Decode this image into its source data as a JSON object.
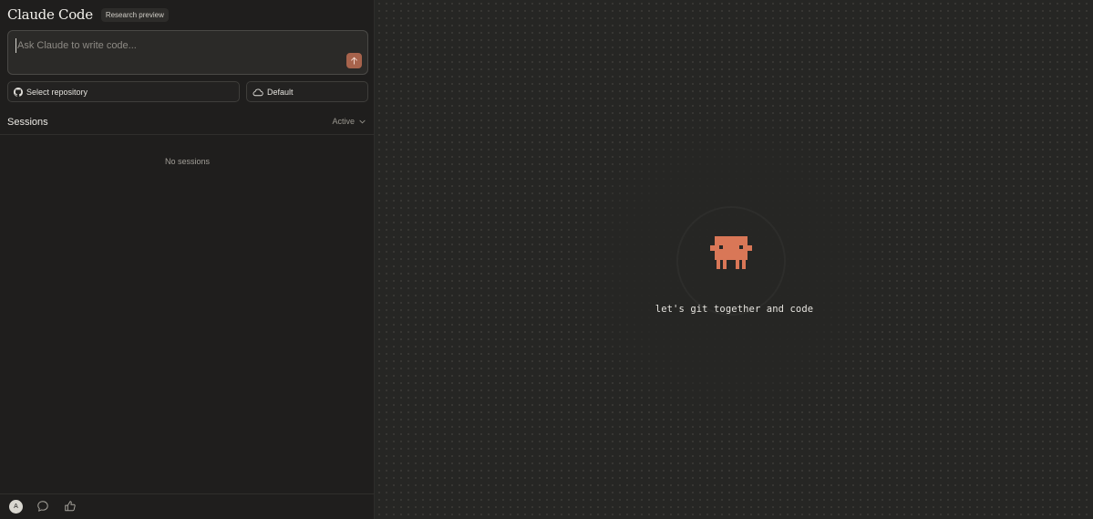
{
  "header": {
    "app_title": "Claude Code",
    "badge": "Research preview"
  },
  "prompt": {
    "placeholder": "Ask Claude to write code...",
    "value": ""
  },
  "controls": {
    "repository_label": "Select repository",
    "environment_label": "Default"
  },
  "sessions": {
    "title": "Sessions",
    "filter_label": "Active",
    "empty_text": "No sessions"
  },
  "footer": {
    "avatar_initial": "A"
  },
  "hero": {
    "tagline": "let's git together and code"
  },
  "colors": {
    "accent": "#d97757",
    "send_button": "#a7634c",
    "left_panel_bg": "#1f1e1d",
    "right_panel_bg": "#262624"
  },
  "icons": [
    "arrow-up-icon",
    "github-icon",
    "cloud-icon",
    "chevron-down-icon",
    "chat-icon",
    "feedback-icon",
    "mascot-icon"
  ]
}
